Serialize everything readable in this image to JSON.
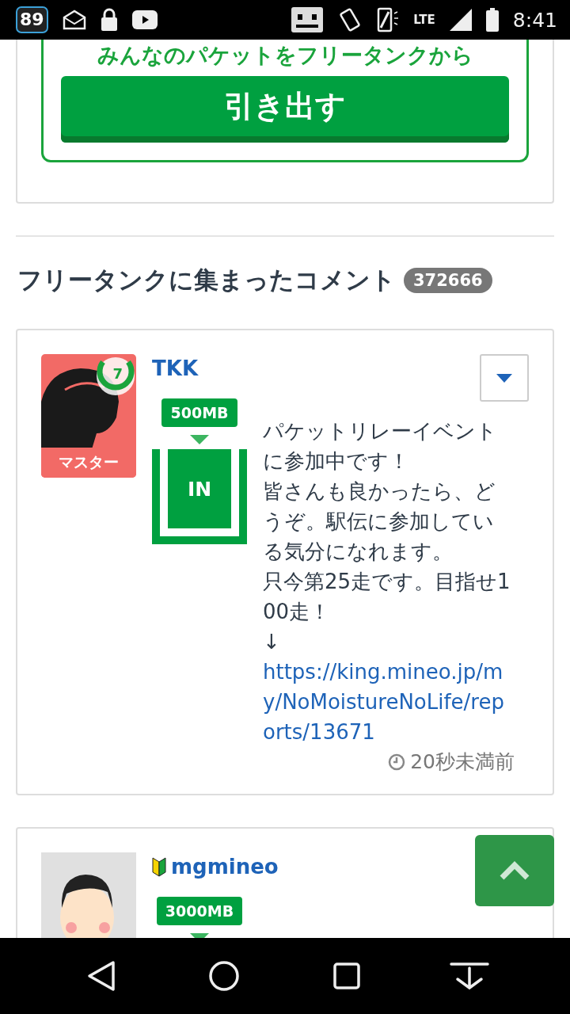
{
  "status_bar": {
    "notification_count": "89",
    "network": "LTE",
    "time": "8:41"
  },
  "freetank": {
    "caption": "みんなのパケットをフリータンクから",
    "button": "引き出す"
  },
  "comments_section": {
    "title": "フリータンクに集まったコメント",
    "count": "372666"
  },
  "comments": [
    {
      "user": "TKK",
      "beginner": false,
      "rank": "マスター",
      "level_badge": "7",
      "amount": "500MB",
      "direction": "IN",
      "body": [
        "パケットリレーイベントに参加中です！",
        "皆さんも良かったら、どうぞ。駅伝に参加している気分になれます。",
        "只今第25走です。目指せ100走！",
        "↓"
      ],
      "link": "https://king.mineo.jp/my/NoMoistureNoLife/reports/13671",
      "time": "20秒未満前"
    },
    {
      "user": "mgmineo",
      "beginner": true,
      "amount": "3000MB"
    }
  ]
}
